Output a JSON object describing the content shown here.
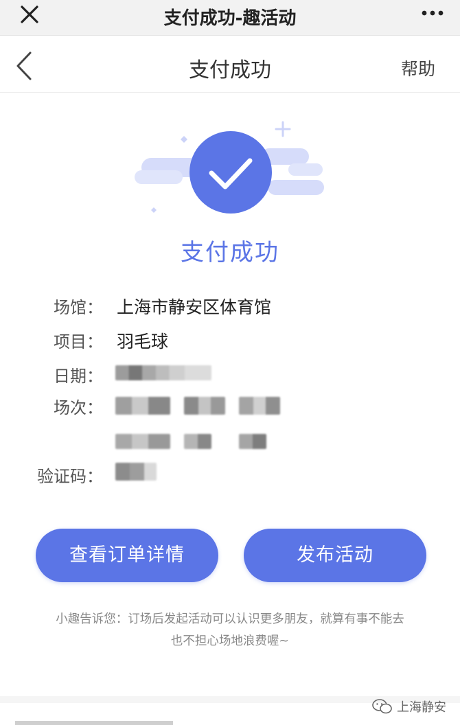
{
  "window": {
    "title": "支付成功-趣活动",
    "close_icon": "close-icon",
    "more_icon": "more-dots-icon"
  },
  "nav": {
    "back_icon": "chevron-left-icon",
    "title": "支付成功",
    "help_label": "帮助"
  },
  "status": {
    "icon": "check-circle-icon",
    "text": "支付成功",
    "accent_color": "#5b75e6",
    "cloud_color": "#d6dcfa"
  },
  "details": {
    "venue_label": "场馆：",
    "venue_value": "上海市静安区体育馆",
    "item_label": "项目：",
    "item_value": "羽毛球",
    "date_label": "日期：",
    "session_label": "场次：",
    "code_label": "验证码："
  },
  "actions": {
    "order_detail_label": "查看订单详情",
    "publish_label": "发布活动"
  },
  "tip": {
    "line1": "小趣告诉您：订场后发起活动可以认识更多朋友，就算有事不能去",
    "line2": "也不担心场地浪费喔~"
  },
  "watermark": {
    "icon": "wechat-icon",
    "text": "上海静安"
  }
}
